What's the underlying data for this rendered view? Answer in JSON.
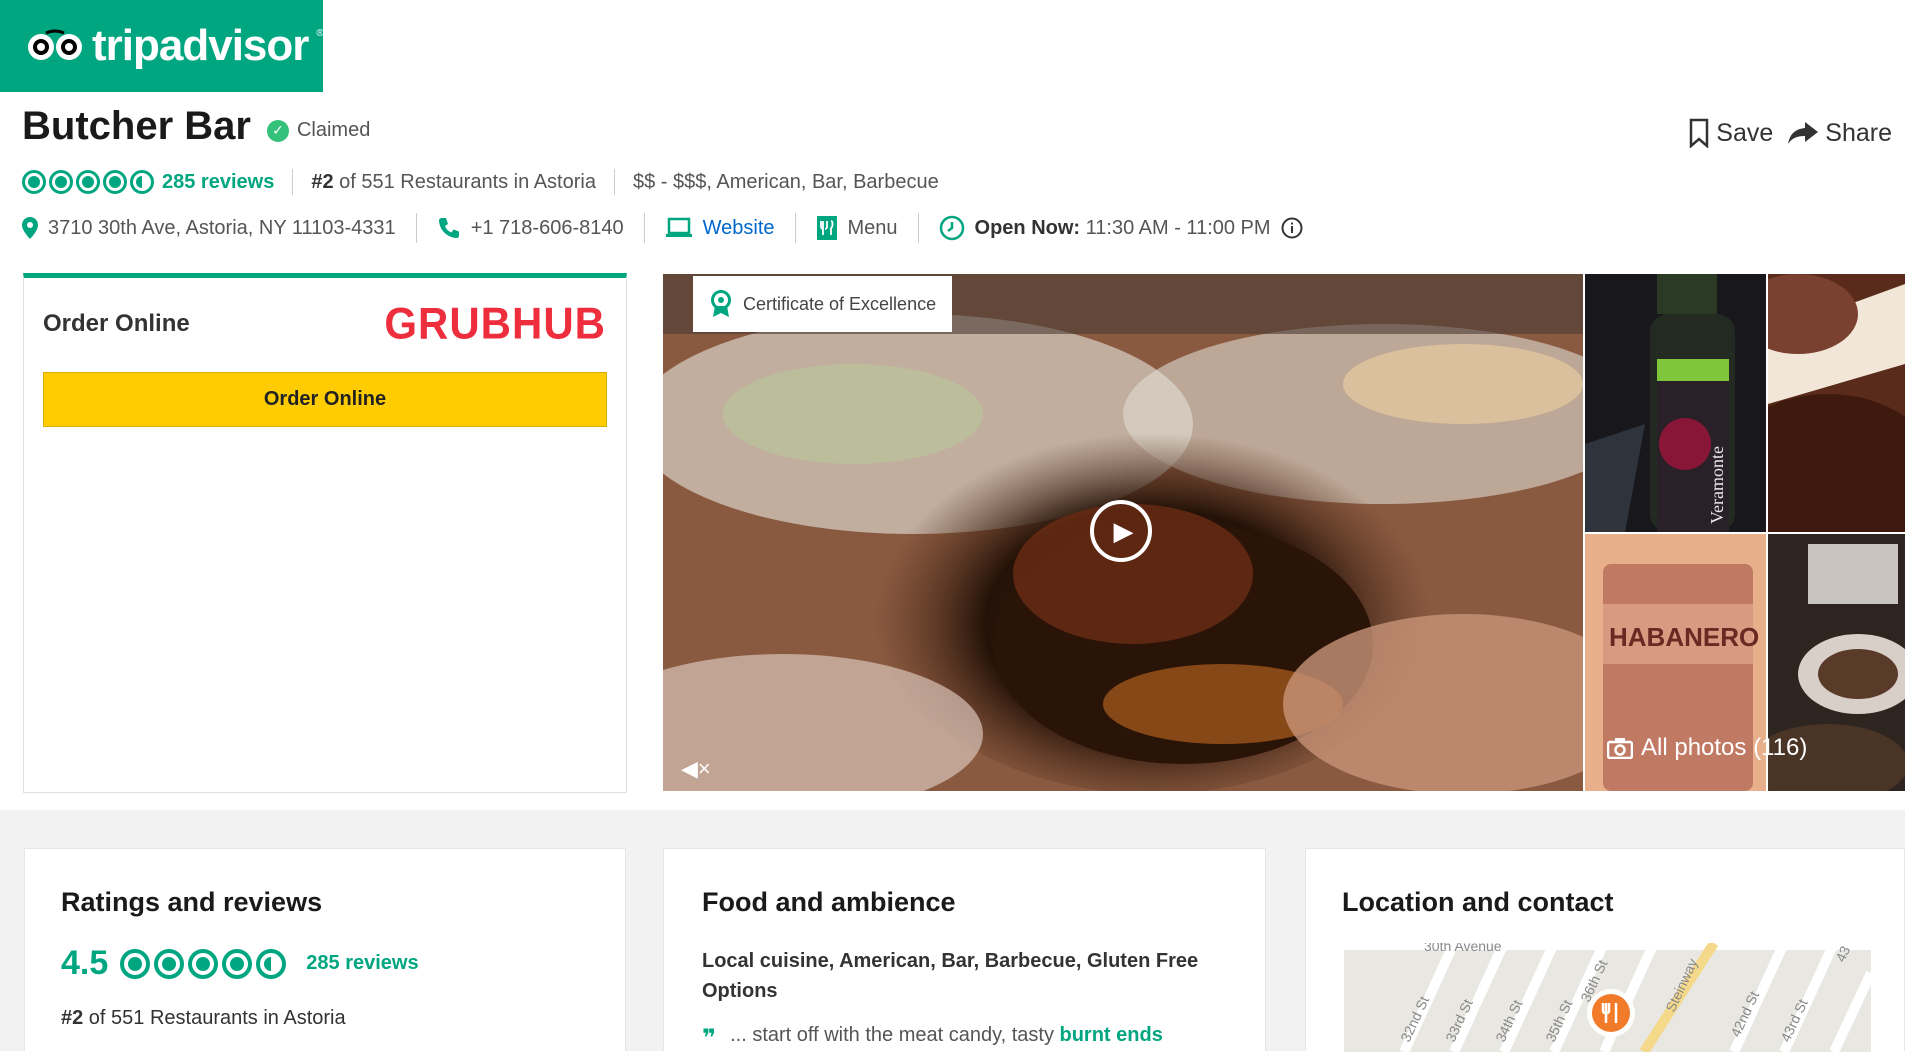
{
  "brand": {
    "name": "tripadvisor",
    "color": "#00a680"
  },
  "restaurant": {
    "name": "Butcher Bar",
    "claimed": "Claimed",
    "reviews": "285 reviews",
    "rating": 4.5,
    "rank_num": "#2",
    "rank_text": " of 551 Restaurants in Astoria",
    "price_cuisine": "$$ - $$$, American, Bar, Barbecue",
    "address": "3710 30th Ave, Astoria, NY 11103-4331",
    "phone": "+1 718-606-8140",
    "website": "Website",
    "menu": "Menu",
    "open_label": "Open Now:",
    "hours": " 11:30 AM - 11:00 PM"
  },
  "actions": {
    "save": "Save",
    "share": "Share"
  },
  "order": {
    "label": "Order Online",
    "provider": "GRUBHUB",
    "button": "Order Online"
  },
  "gallery": {
    "certificate": "Certificate of Excellence",
    "all_photos": "All photos (116)",
    "habanero_text": "HABANERO",
    "bottle_text": "Veramonte"
  },
  "cards": {
    "ratings": {
      "title": "Ratings and reviews",
      "score": "4.5",
      "reviews": "285 reviews",
      "rank_num": "#2",
      "rank_text": " of 551 Restaurants in Astoria"
    },
    "food": {
      "title": "Food and ambience",
      "cuisines": "Local cuisine, American, Bar, Barbecue, Gluten Free Options",
      "quote_prefix": "... start off with the meat candy, tasty ",
      "quote_link": "burnt ends"
    },
    "location": {
      "title": "Location and contact",
      "streets": [
        "30th Avenue",
        "32nd St",
        "33rd St",
        "34th St",
        "35th St",
        "36th St",
        "Steinway",
        "42nd St",
        "43rd St",
        "43"
      ]
    }
  }
}
